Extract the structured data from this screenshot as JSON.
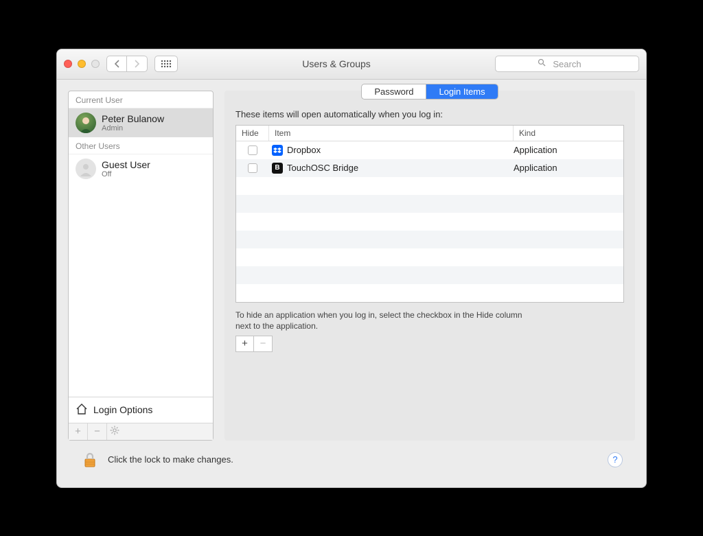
{
  "window": {
    "title": "Users & Groups",
    "search_placeholder": "Search"
  },
  "sidebar": {
    "section_current": "Current User",
    "section_other": "Other Users",
    "current_user": {
      "name": "Peter Bulanow",
      "role": "Admin"
    },
    "other_users": [
      {
        "name": "Guest User",
        "role": "Off"
      }
    ],
    "login_options_label": "Login Options"
  },
  "tabs": {
    "password": "Password",
    "login_items": "Login Items",
    "active": "login_items"
  },
  "table": {
    "prompt": "These items will open automatically when you log in:",
    "columns": {
      "hide": "Hide",
      "item": "Item",
      "kind": "Kind"
    },
    "rows": [
      {
        "hide": false,
        "item": "Dropbox",
        "kind": "Application",
        "icon": "dropbox"
      },
      {
        "hide": false,
        "item": "TouchOSC Bridge",
        "kind": "Application",
        "icon": "bridge"
      }
    ],
    "hint": "To hide an application when you log in, select the checkbox in the Hide column next to the application."
  },
  "footer": {
    "lock_text": "Click the lock to make changes."
  }
}
